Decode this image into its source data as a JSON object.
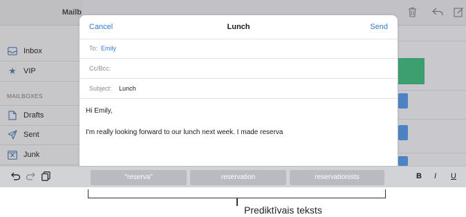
{
  "sidebar": {
    "header_title": "Mailb",
    "items": [
      {
        "label": "Inbox",
        "icon": "inbox-tray-icon"
      },
      {
        "label": "VIP",
        "icon": "star-icon"
      }
    ],
    "section_title": "MAILBOXES",
    "mailboxes": [
      {
        "label": "Drafts",
        "icon": "document-icon"
      },
      {
        "label": "Sent",
        "icon": "paper-plane-icon"
      },
      {
        "label": "Junk",
        "icon": "junk-box-icon"
      }
    ]
  },
  "compose": {
    "cancel_label": "Cancel",
    "title": "Lunch",
    "send_label": "Send",
    "to_label": "To:",
    "to_value": "Emily",
    "ccbcc_label": "Cc/Bcc:",
    "subject_label": "Subject:",
    "subject_value": "Lunch",
    "greeting": "Hi Emily,",
    "body_line": "I'm really looking forward to our lunch next week. I made reserva"
  },
  "keyboard_bar": {
    "predictions": [
      "\"reserva\"",
      "reservation",
      "reservationists"
    ],
    "bold": "B",
    "italic": "I",
    "underline": "U"
  },
  "callout": {
    "label": "Prediktīvais teksts"
  },
  "colors": {
    "accent": "#2e7bd6",
    "green_tile": "#3d9e6f",
    "blue_marker": "#4b83c4"
  }
}
